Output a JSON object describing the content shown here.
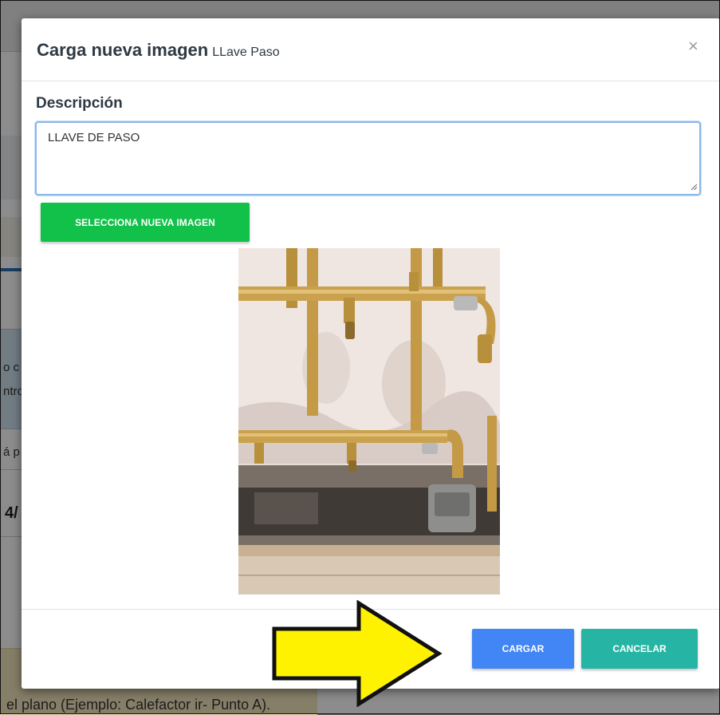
{
  "modal": {
    "title": "Carga nueva imagen",
    "subtitle": "LLave Paso",
    "close_glyph": "×",
    "description_label": "Descripción",
    "description_value": "LLAVE DE PASO",
    "select_image_label": "SELECCIONA NUEVA IMAGEN",
    "preview_alt": "Foto de llave de paso (cañerías de gas)",
    "submit_label": "CARGAR",
    "cancel_label": "CANCELAR"
  },
  "background": {
    "fragments": [
      "o c",
      "ntro",
      "á p",
      "4/"
    ],
    "bottom_text": "el plano (Ejemplo: Calefactor ir- Punto A)."
  },
  "colors": {
    "select_button": "#11c14a",
    "submit_button": "#4285f4",
    "cancel_button": "#26b5a4",
    "annotation_arrow": "#fff200"
  },
  "icons": {
    "close": "close-icon",
    "annotation": "arrow-right-icon"
  }
}
